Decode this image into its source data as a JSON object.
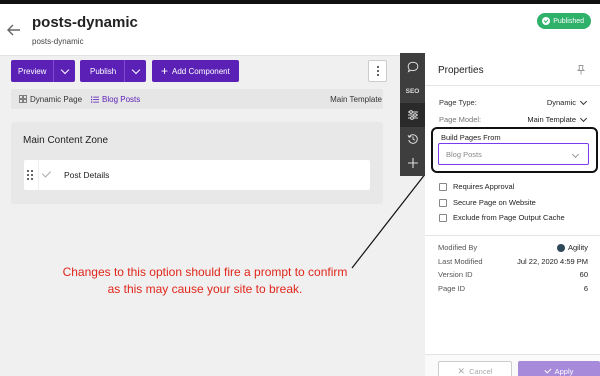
{
  "page": {
    "title": "posts-dynamic",
    "subtitle": "posts-dynamic",
    "status": "Published"
  },
  "toolbar": {
    "preview_label": "Preview",
    "publish_label": "Publish",
    "add_component_label": "Add Component"
  },
  "breadcrumb": {
    "items": [
      "Dynamic Page",
      "Blog Posts"
    ],
    "template": "Main Template"
  },
  "zone": {
    "title": "Main Content Zone",
    "modules": [
      "Post Details"
    ]
  },
  "annotation": {
    "line1": "Changes to this option should fire a prompt to confirm",
    "line2": "as this may cause your site to break.",
    "color": "#e0261b"
  },
  "rail": {
    "seo_label": "SEO",
    "icons": [
      "comment-icon",
      "seo-icon",
      "sliders-icon",
      "history-icon",
      "plus-icon"
    ]
  },
  "properties": {
    "title": "Properties",
    "page_type_label": "Page Type:",
    "page_type_value": "Dynamic",
    "page_model_label": "Page Model:",
    "page_model_value": "Main Template",
    "build_from_label": "Build Pages From",
    "build_from_value": "Blog Posts",
    "checkboxes": [
      "Requires Approval",
      "Secure Page on Website",
      "Exclude from Page Output Cache"
    ],
    "meta": {
      "modified_by_label": "Modified By",
      "modified_by_value": "Agility",
      "last_modified_label": "Last Modified",
      "last_modified_value": "Jul 22, 2020 4:59 PM",
      "version_id_label": "Version ID",
      "version_id_value": "60",
      "page_id_label": "Page ID",
      "page_id_value": "6"
    },
    "cancel_label": "Cancel",
    "apply_label": "Apply"
  },
  "colors": {
    "accent": "#5b21b6",
    "published": "#2fb16a",
    "annotation": "#e0261b"
  }
}
